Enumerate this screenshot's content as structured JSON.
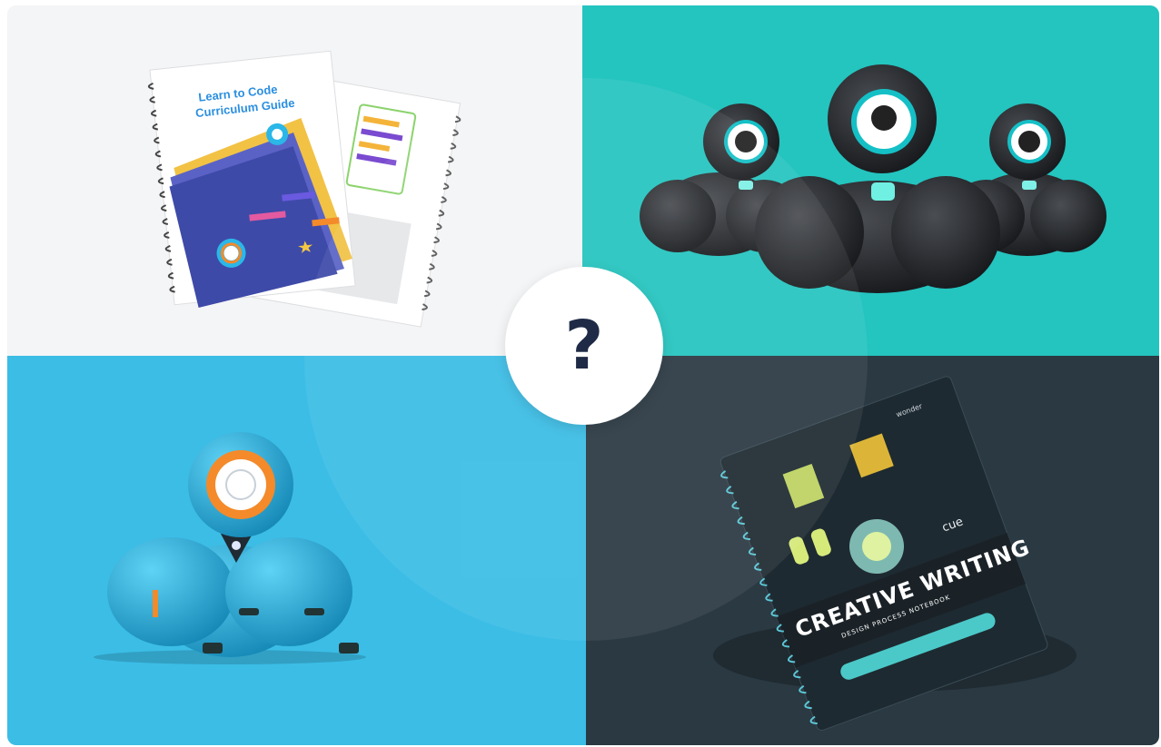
{
  "center": {
    "label": "?"
  },
  "products": {
    "curriculum_guide": {
      "title_line1": "Learn to Code",
      "title_line2": "Curriculum Guide"
    },
    "cue_robots": {
      "icon": "cue-robot-icon"
    },
    "dash_robot": {
      "icon": "dash-robot-icon"
    },
    "creative_writing": {
      "brand": "wonder",
      "cue_label": "cue",
      "title": "CREATIVE WRITING",
      "subtitle": "DESIGN PROCESS NOTEBOOK"
    }
  },
  "colors": {
    "top_left_bg": "#f4f5f6",
    "top_right_bg": "#24c4bf",
    "bottom_left_bg": "#3bbde6",
    "bottom_right_bg": "#2a3942",
    "question_mark": "#1f2a46"
  }
}
